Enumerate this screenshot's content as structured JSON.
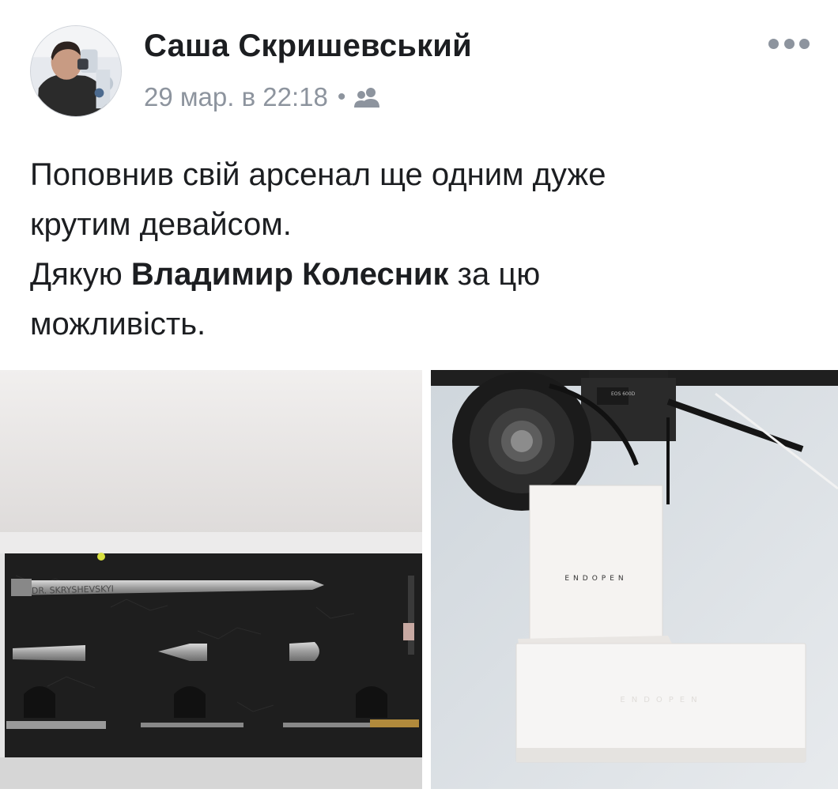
{
  "post": {
    "author": "Саша Скришевський",
    "timestamp": "29 мар. в 22:18",
    "separator": "•",
    "audience_icon": "friends-icon",
    "more_icon": "more-dots-icon",
    "text": {
      "line1": "Поповнив свій арсенал ще одним дуже",
      "line2": "крутим девайсом.",
      "line3_prefix": "Дякую ",
      "mention": "Владимир Колесник",
      "line3_suffix": " за цю",
      "line4": "можливість."
    }
  },
  "photos": {
    "left": {
      "engraving": "DR. SKRYSHEVSKYI"
    },
    "right": {
      "card_logo": "ENDOPEN",
      "box_logo": "ENDOPEN",
      "camera_badge": "EOS 600D"
    }
  },
  "colors": {
    "text": "#1c1e21",
    "secondary": "#8d949e",
    "background": "#ffffff"
  }
}
